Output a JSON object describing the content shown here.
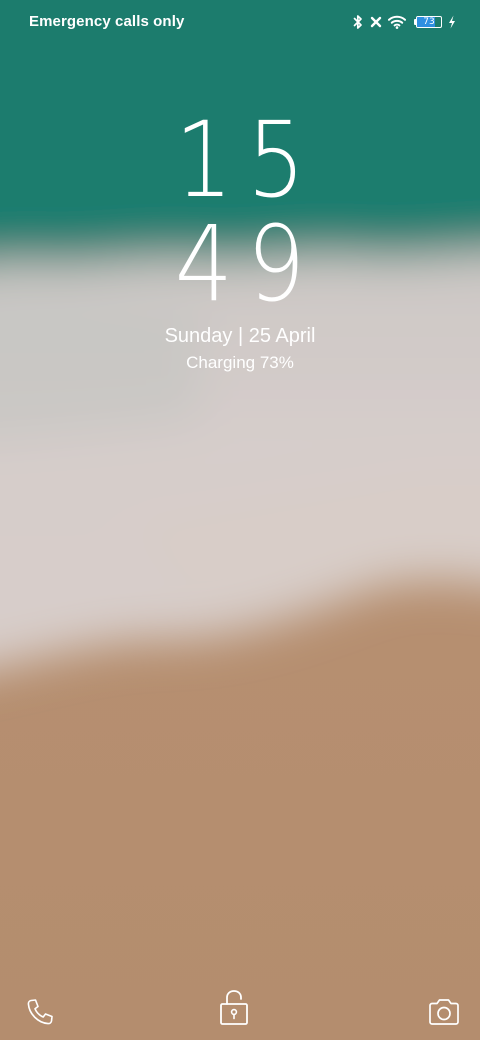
{
  "status_bar": {
    "carrier_text": "Emergency calls only",
    "icons": [
      "bluetooth-icon",
      "no-sim-icon",
      "wifi-icon",
      "battery-icon",
      "charging-bolt-icon"
    ],
    "battery_level": "73",
    "battery_fraction": 0.73,
    "battery_fill_color": "#2f8fe0"
  },
  "lockscreen": {
    "clock_hours": "15",
    "clock_minutes": "49",
    "date": "Sunday | 25 April",
    "charging": "Charging 73%"
  },
  "shortcuts": {
    "left": "phone-icon",
    "center": "unlock-icon",
    "right": "camera-icon"
  },
  "colors": {
    "sea": "#1a7a6c",
    "foam": "#d9d0ce",
    "sand": "#b48e6f"
  }
}
